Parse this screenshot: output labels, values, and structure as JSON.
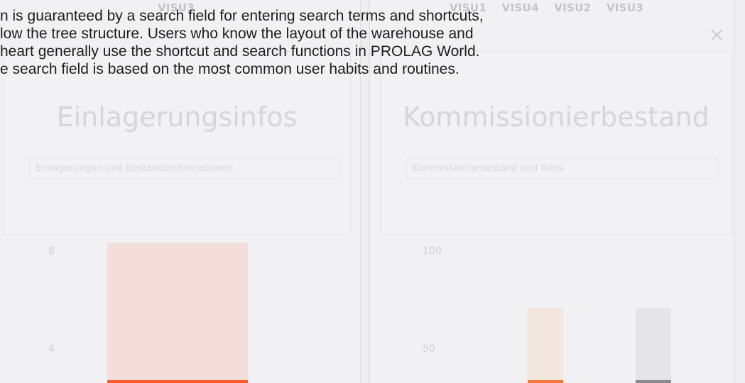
{
  "background": {
    "left_tabs": [
      "VISU3"
    ],
    "right_tabs": [
      "VISU1",
      "VISU4",
      "VISU2",
      "VISU3"
    ],
    "left_card_title": "Einlagerungsinfos",
    "right_card_title": "Kommissionierbestand",
    "left_card_desc": "Einlagerungen und Bestandsinformationen",
    "right_card_desc": "Kommissionierbestand und Infos",
    "left_chart_labels": [
      "8",
      "4"
    ],
    "right_chart_labels": [
      "100",
      "50"
    ],
    "close_symbol": "×"
  },
  "overlay": {
    "lines": [
      "n is guaranteed by a search field for entering search terms and shortcuts,",
      "low the tree structure. Users who know the layout of the warehouse and",
      "heart generally use the shortcut and search functions in PROLAG World.",
      "e search field is based on the most common user habits and routines."
    ]
  },
  "colors": {
    "bar_accent_left": "#ff5a2c",
    "bar_faded_left": "#f3dedc",
    "bar_accent_right_1": "#ef7a3a",
    "bar_faded_right_1": "#f3e6dc",
    "bar_accent_right_2": "#8a8a8a",
    "bar_faded_right_2": "#e5e5e7"
  }
}
